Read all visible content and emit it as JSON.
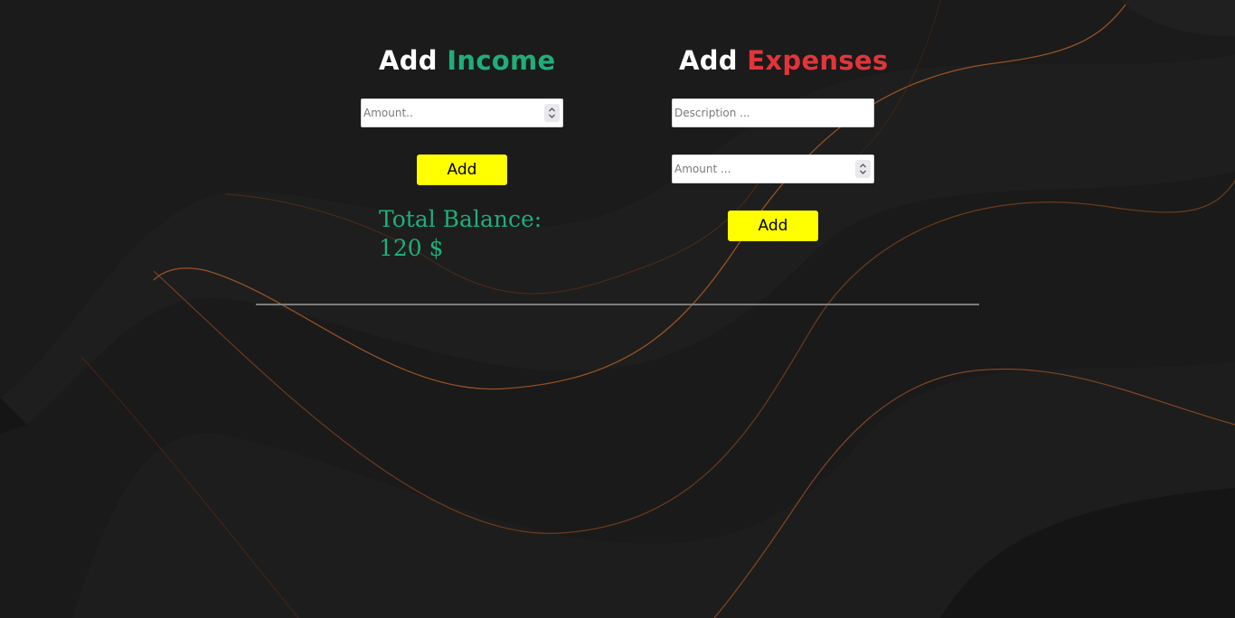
{
  "colors": {
    "background": "#161616",
    "income_accent": "#1fae7a",
    "expenses_accent": "#e2353a",
    "button": "#ffff00",
    "wave_line": "#c0642a",
    "divider": "#7d7d7d"
  },
  "income": {
    "title_word": "Add",
    "title_accent": "Income",
    "amount_placeholder": "Amount..",
    "add_label": "Add",
    "balance_label": "Total Balance:",
    "balance_value": "120 $"
  },
  "expenses": {
    "title_word": "Add",
    "title_accent": "Expenses",
    "description_placeholder": "Description ...",
    "amount_placeholder": "Amount ...",
    "add_label": "Add"
  }
}
